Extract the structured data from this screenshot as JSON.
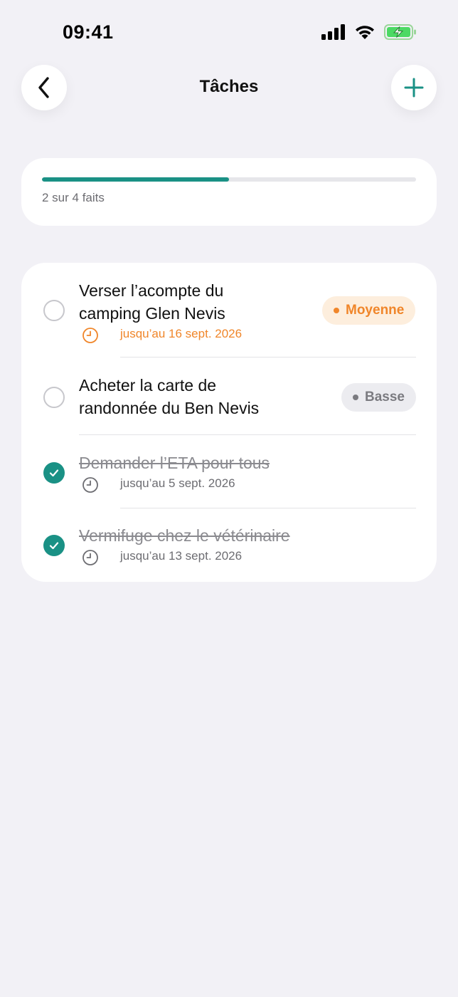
{
  "status_bar": {
    "time": "09:41"
  },
  "header": {
    "title": "Tâches",
    "back_icon": "chevron-left-icon",
    "add_icon": "plus-icon"
  },
  "progress": {
    "label": "2 sur 4 faits",
    "done": 2,
    "total": 4,
    "fraction": 0.5
  },
  "colors": {
    "accent": "#1a9185",
    "medium": "#f0862a",
    "low": "#7b7b80",
    "background": "#f2f1f6"
  },
  "tasks": [
    {
      "title_line1": "Verser l’acompte du",
      "title_line2": "camping Glen Nevis",
      "due": "jusqu’au 16 sept. 2026",
      "priority": "Moyenne",
      "done": false
    },
    {
      "title_line1": "Acheter la carte de",
      "title_line2": "randonnée du Ben Nevis",
      "due": "",
      "priority": "Basse",
      "done": false
    },
    {
      "title": "Demander l’ETA pour tous",
      "due": "jusqu’au 5 sept. 2026",
      "done": true
    },
    {
      "title": "Vermifuge chez le vétérinaire",
      "due": "jusqu’au 13 sept. 2026",
      "done": true
    }
  ]
}
